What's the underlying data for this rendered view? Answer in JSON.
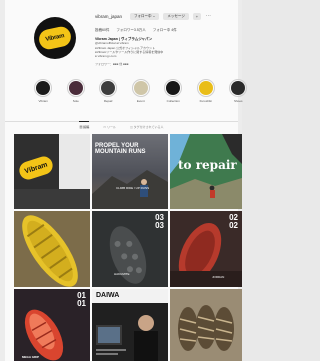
{
  "profile": {
    "username": "vibram_japan",
    "logo_text": "Vibram",
    "follow_label": "フォロー中 ⌄",
    "message_label": "メッセージ",
    "add_icon": "person-add-icon",
    "more_icon": "more-icon",
    "stats": [
      "投稿60件",
      "フォロワー3.5万人",
      "フォロー中 4件"
    ],
    "bio_name": "Vibram Japan | ヴィブラムジャパン",
    "bio_lines": [
      "@vibramofficial at vibram",
      "●Vibram Japan 公式オフィシャルアカウント",
      "●Vibramソールやソール作りに関する情報を発信中",
      "● vibram.jp.com"
    ],
    "followed_by": "フォロワー：■■■ 他 ■■■"
  },
  "highlights": [
    {
      "label": "Vibram",
      "color": "#1c1c1c"
    },
    {
      "label": "Sole",
      "color": "#4a2c3a"
    },
    {
      "label": "Repair",
      "color": "#3d3d3d"
    },
    {
      "label": "Event",
      "color": "#cfc6a8"
    },
    {
      "label": "Collection",
      "color": "#171717"
    },
    {
      "label": "Furoshiki",
      "color": "#e9bd18"
    },
    {
      "label": "Shoes",
      "color": "#2a2a2a"
    }
  ],
  "tabs": [
    {
      "label": "▦ 投稿",
      "active": true
    },
    {
      "label": "▭ リール",
      "active": false
    },
    {
      "label": "◫ タグ付けされている人",
      "active": false
    }
  ],
  "posts": [
    {
      "name": "post-vibram-logo",
      "bg": "#2b2b2b",
      "text": ""
    },
    {
      "name": "post-mountain-runs",
      "bg": "#5e6068",
      "text": "PROPEL YOUR MOUNTAIN RUNS",
      "foot": "CLIMB RIDE / UP RUNS"
    },
    {
      "name": "post-to-repair",
      "bg": "#3f7a4e",
      "text": "to repair"
    },
    {
      "name": "post-yellow-sole",
      "bg": "#b8962a",
      "text": ""
    },
    {
      "name": "post-sole-03",
      "bg": "#3a3d3e",
      "num": "03\n03",
      "foot": "HAKUMITE"
    },
    {
      "name": "post-sole-02",
      "bg": "#5b2e2a",
      "num": "02\n02",
      "foot": "JORDAN"
    },
    {
      "name": "post-shoe-01",
      "bg": "#3a2b33",
      "num": "01\n01",
      "foot": "MEGA GRIP"
    },
    {
      "name": "post-daiwa",
      "bg": "#2c2c2c",
      "text": "DAIWA"
    },
    {
      "name": "post-sandals",
      "bg": "#8a7c66",
      "text": ""
    }
  ]
}
